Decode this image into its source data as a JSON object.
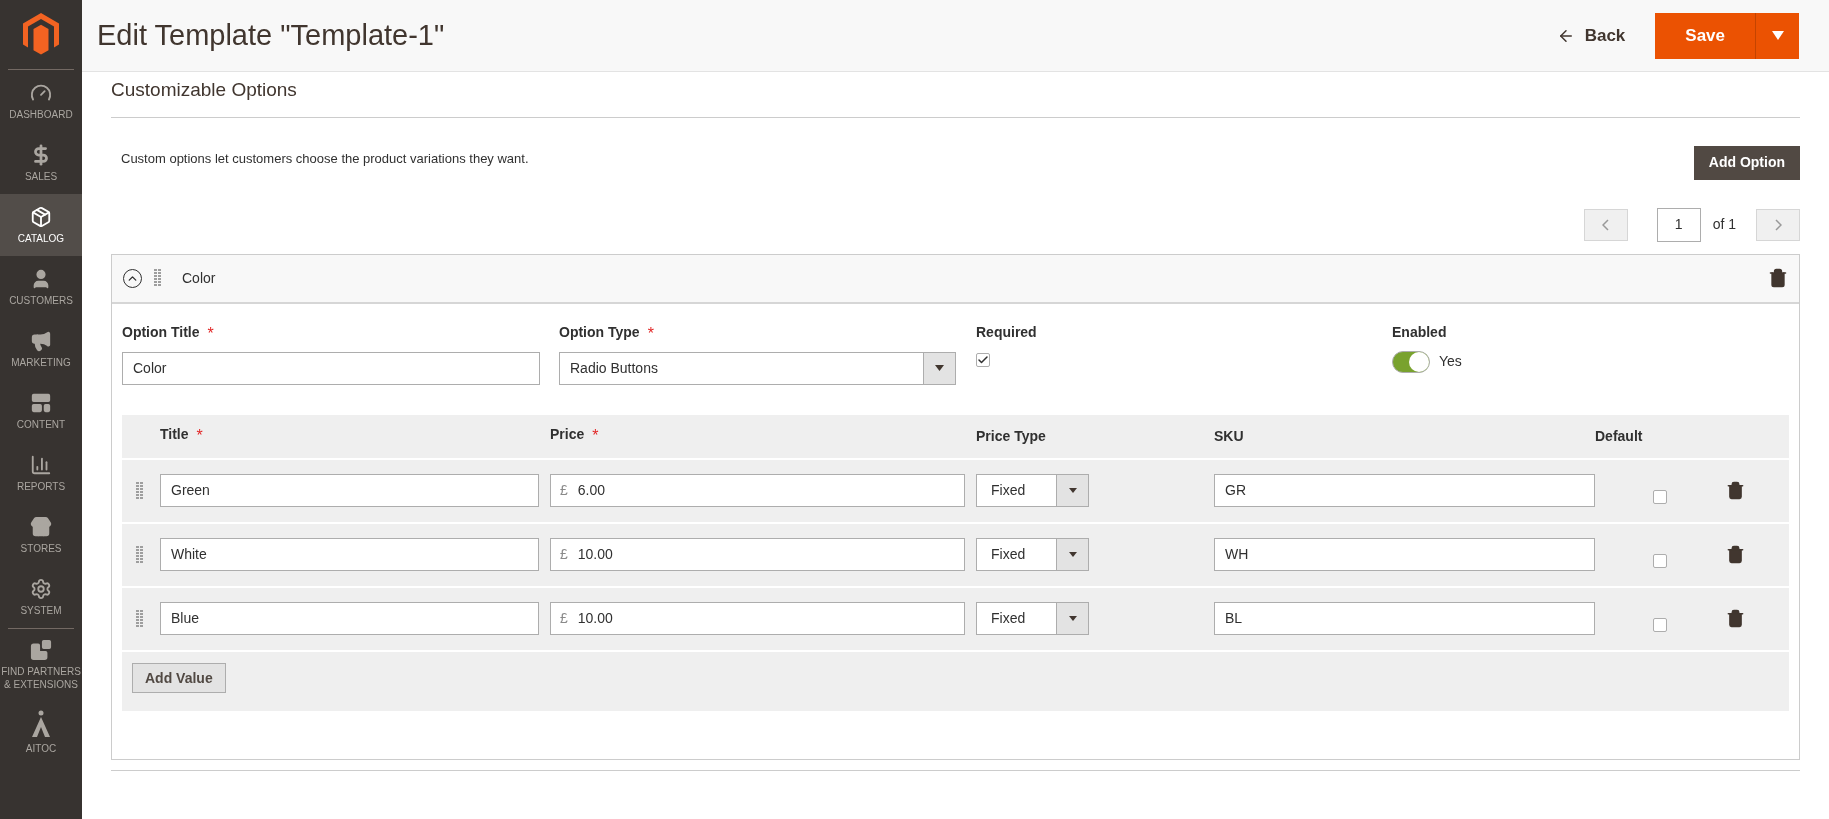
{
  "sidebar": {
    "items": [
      {
        "label": "DASHBOARD",
        "selected": false
      },
      {
        "label": "SALES",
        "selected": false
      },
      {
        "label": "CATALOG",
        "selected": true
      },
      {
        "label": "CUSTOMERS",
        "selected": false
      },
      {
        "label": "MARKETING",
        "selected": false
      },
      {
        "label": "CONTENT",
        "selected": false
      },
      {
        "label": "REPORTS",
        "selected": false
      },
      {
        "label": "STORES",
        "selected": false
      },
      {
        "label": "SYSTEM",
        "selected": false
      },
      {
        "label": "FIND PARTNERS & EXTENSIONS",
        "selected": false
      },
      {
        "label": "AITOC",
        "selected": false
      }
    ]
  },
  "header": {
    "title": "Edit Template \"Template-1\"",
    "back": "Back",
    "save": "Save"
  },
  "section": {
    "title": "Customizable Options",
    "description": "Custom options let customers choose the product variations they want.",
    "add_option": "Add Option"
  },
  "pager": {
    "page": "1",
    "of": "of 1"
  },
  "required_mark": "*",
  "option": {
    "name": "Color",
    "expanded": true,
    "title_label": "Option Title",
    "title_required": true,
    "title_value": "Color",
    "type_label": "Option Type",
    "type_required": true,
    "type_value": "Radio Buttons",
    "required_label": "Required",
    "required": true,
    "enabled_label": "Enabled",
    "enabled": true,
    "enabled_text": "Yes",
    "columns": [
      {
        "label": "Title",
        "required": true
      },
      {
        "label": "Price",
        "required": true
      },
      {
        "label": "Price Type",
        "required": false
      },
      {
        "label": "SKU",
        "required": false
      },
      {
        "label": "Default",
        "required": false
      }
    ],
    "rows": [
      {
        "title": "Green",
        "currency": "£",
        "price": "6.00",
        "price_type": "Fixed",
        "sku": "GR",
        "default": false
      },
      {
        "title": "White",
        "currency": "£",
        "price": "10.00",
        "price_type": "Fixed",
        "sku": "WH",
        "default": false
      },
      {
        "title": "Blue",
        "currency": "£",
        "price": "10.00",
        "price_type": "Fixed",
        "sku": "BL",
        "default": false
      }
    ],
    "add_value": "Add Value"
  }
}
